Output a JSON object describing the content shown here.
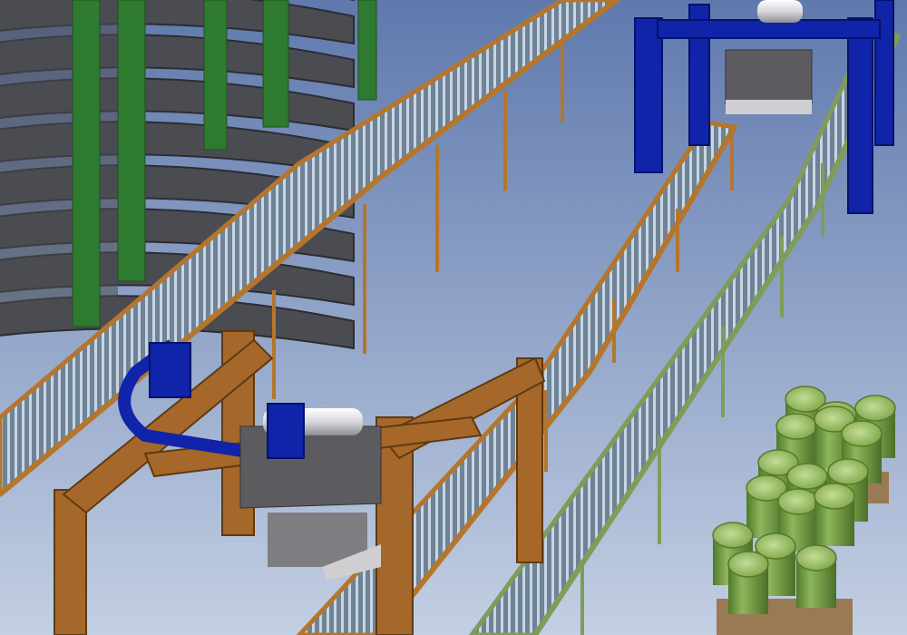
{
  "scene": {
    "kind": "3d-conveyor-layout-render",
    "colors": {
      "sky_top": "#5f79ad",
      "sky_bottom": "#c3cfe3",
      "spiral_silo": "#4a4c52",
      "spiral_edge": "#2c2d31",
      "steel_green": "#2f7a31",
      "roller_light": "#c7d5e4",
      "roller_dark": "#6f8396",
      "rail_wood": "#b5762b",
      "rail_green": "#7f9d58",
      "gantry_wood": "#a6672a",
      "gantry_blue": "#0f24a8",
      "vacuum_head": "#5c5c60",
      "barrel_green": "#6f9a3e",
      "barrel_top": "#9cbf6a",
      "pallet": "#9a7a55"
    },
    "objects": [
      {
        "name": "spiral-silo"
      },
      {
        "name": "main-conveyor"
      },
      {
        "name": "middle-conveyor"
      },
      {
        "name": "right-conveyor"
      },
      {
        "name": "wood-gantry-robot"
      },
      {
        "name": "blue-gantry-robot"
      },
      {
        "name": "barrel-stacks"
      }
    ]
  }
}
